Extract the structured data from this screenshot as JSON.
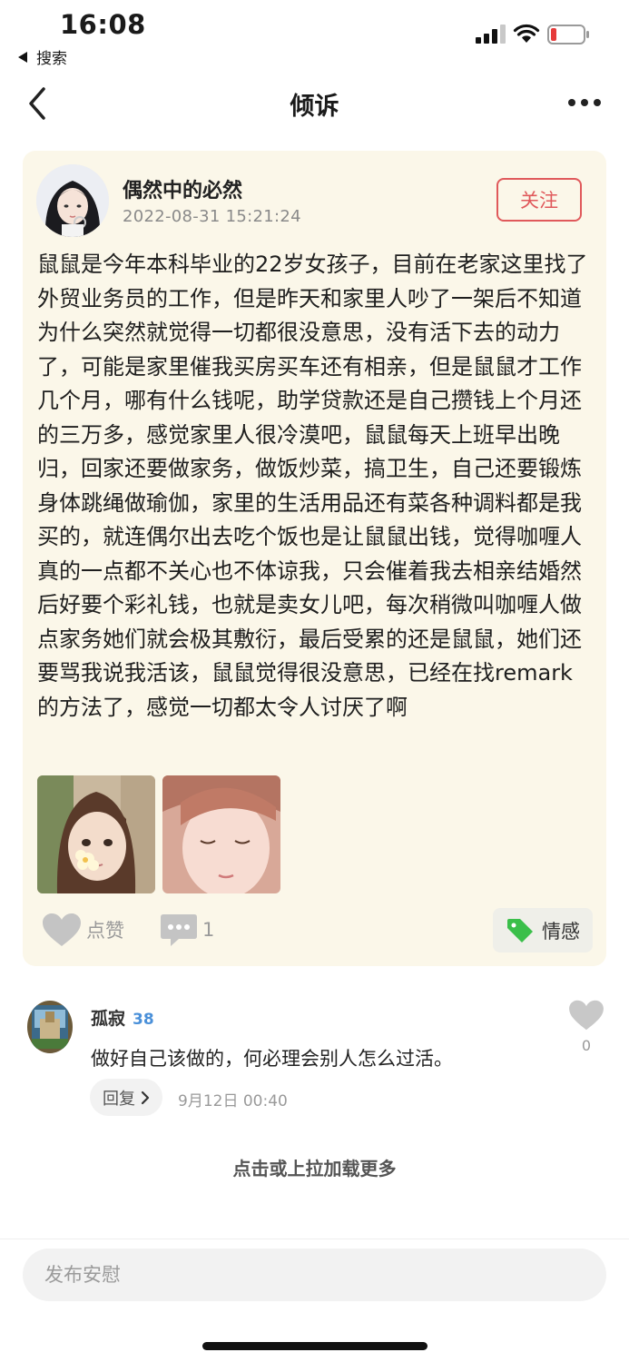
{
  "status_bar": {
    "time": "16:08",
    "back_app_label": "搜索"
  },
  "nav": {
    "title": "倾诉"
  },
  "post": {
    "author": "偶然中的必然",
    "timestamp": "2022-08-31 15:21:24",
    "follow_label": "关注",
    "body": "鼠鼠是今年本科毕业的22岁女孩子，目前在老家这里找了外贸业务员的工作，但是昨天和家里人吵了一架后不知道为什么突然就觉得一切都很没意思，没有活下去的动力了，可能是家里催我买房买车还有相亲，但是鼠鼠才工作几个月，哪有什么钱呢，助学贷款还是自己攒钱上个月还的三万多，感觉家里人很冷漠吧，鼠鼠每天上班早出晚归，回家还要做家务，做饭炒菜，搞卫生，自己还要锻炼身体跳绳做瑜伽，家里的生活用品还有菜各种调料都是我买的，就连偶尔出去吃个饭也是让鼠鼠出钱，觉得咖喱人真的一点都不关心也不体谅我，只会催着我去相亲结婚然后好要个彩礼钱，也就是卖女儿吧，每次稍微叫咖喱人做点家务她们就会极其敷衍，最后受累的还是鼠鼠，她们还要骂我说我活该，鼠鼠觉得很没意思，已经在找remark 的方法了，感觉一切都太令人讨厌了啊",
    "like_label": "点赞",
    "comment_count": "1",
    "tag_label": "情感"
  },
  "comment": {
    "user": "孤寂",
    "level": "38",
    "text": "做好自己该做的，何必理会别人怎么过活。",
    "reply_label": "回复",
    "time": "9月12日 00:40",
    "like_count": "0"
  },
  "load_more_label": "点击或上拉加载更多",
  "comfort_input": {
    "placeholder": "发布安慰"
  },
  "colors": {
    "card_bg": "#fbf7e9",
    "follow_red": "#e0595b",
    "level_blue": "#4a90d9",
    "tag_green": "#3bbf4a"
  }
}
